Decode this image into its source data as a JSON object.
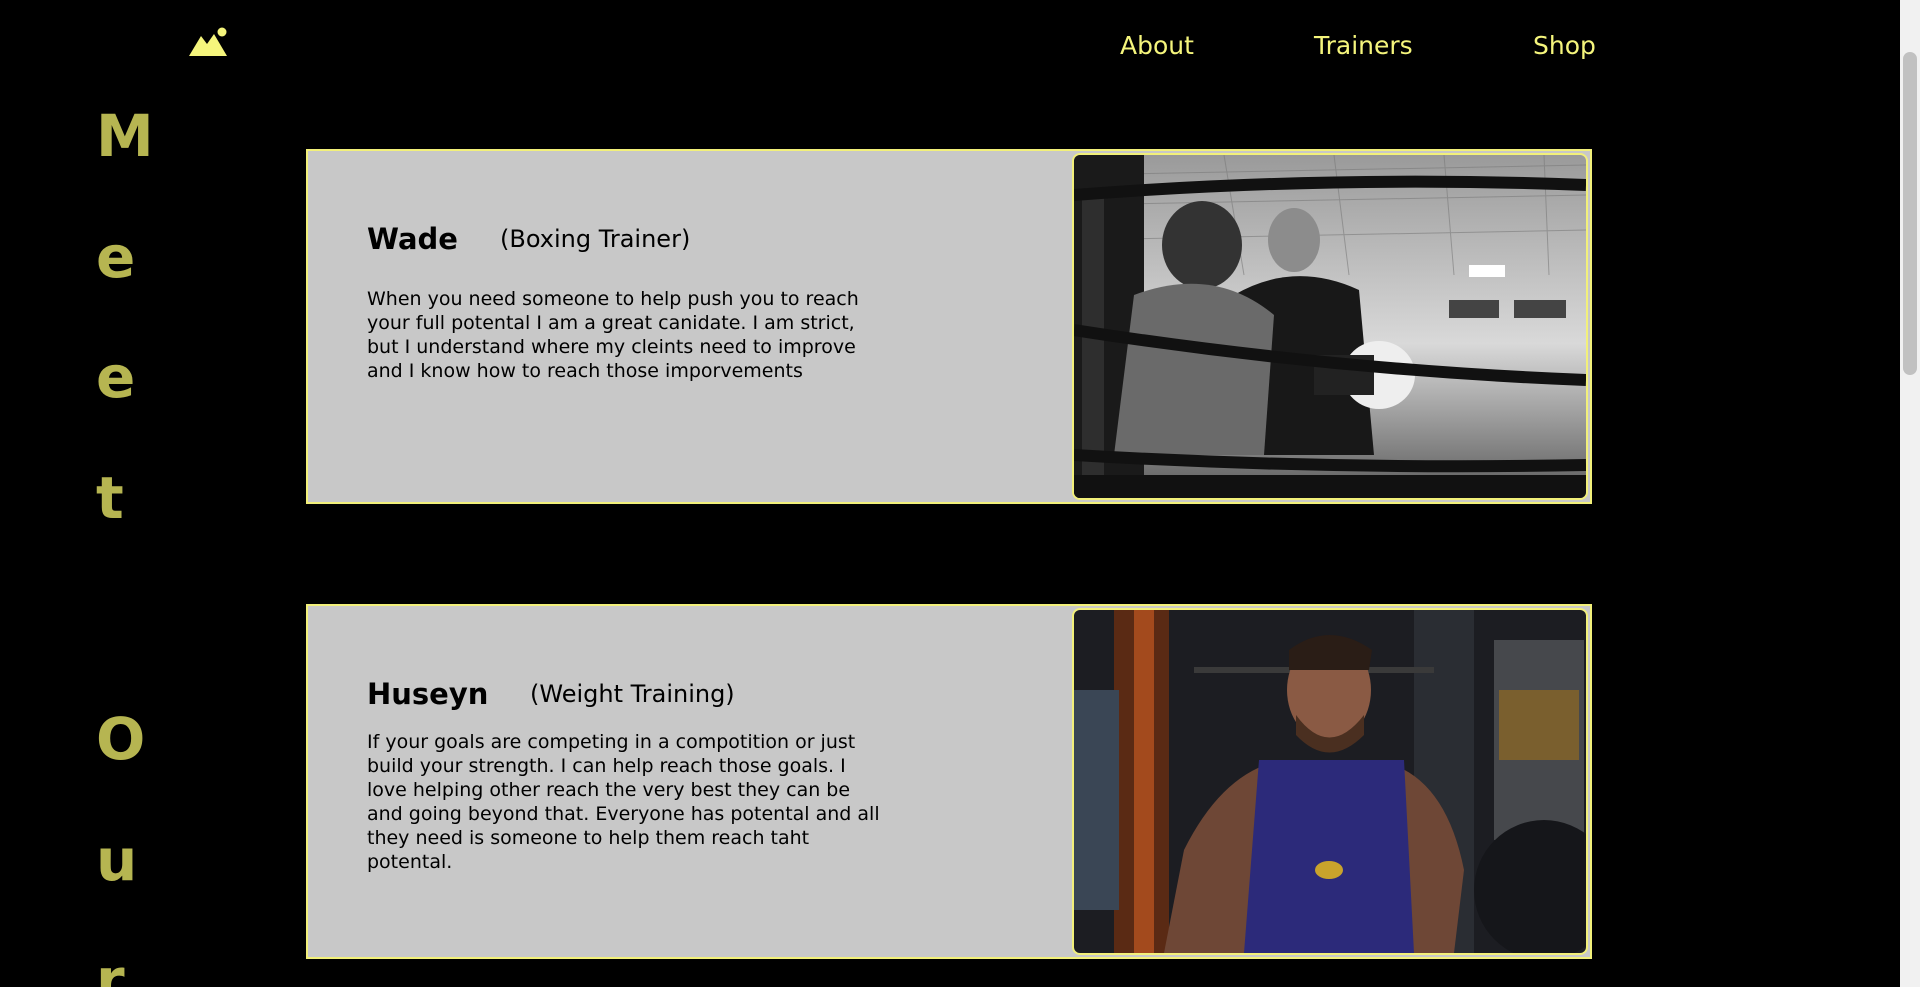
{
  "nav": {
    "logo_icon": "mountain-sun-icon",
    "items": [
      {
        "label": "About"
      },
      {
        "label": "Trainers"
      },
      {
        "label": "Shop"
      }
    ]
  },
  "side_title": {
    "letters": [
      "M",
      "e",
      "e",
      "t",
      "O",
      "u",
      "r"
    ]
  },
  "trainers": [
    {
      "name": "Wade",
      "role": "(Boxing Trainer)",
      "bio": "When you need someone to help push you to reach your full potental I am a great canidate. I am strict, but I understand where my cleints need to improve and I know how to reach those imporvements",
      "photo_icon": "boxing-ring-photo"
    },
    {
      "name": "Huseyn",
      "role": "(Weight Training)",
      "bio": "If your goals are competing in a compotition or just build your strength. I can help reach those goals. I love helping other reach the very best they can be and going beyond that. Everyone has potental and all they need is someone to help them reach taht potental.",
      "photo_icon": "gym-trainer-photo"
    }
  ],
  "colors": {
    "background": "#000000",
    "accent": "#f5f57c",
    "side_title": "#b6b551",
    "card": "#c8c8c8",
    "border": "#f2f07a"
  }
}
